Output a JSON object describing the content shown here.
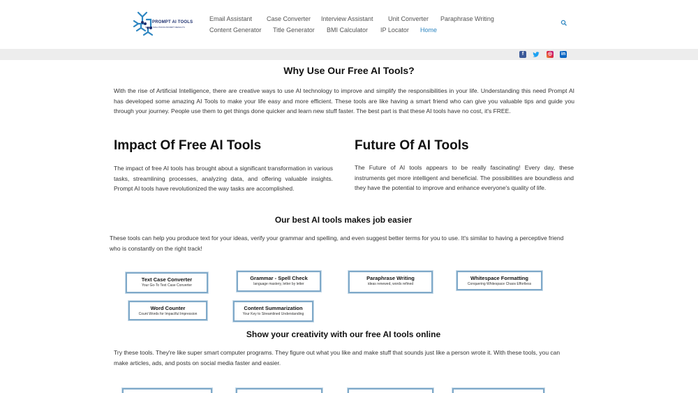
{
  "header": {
    "logo_text": "PROMPT AI TOOLS",
    "logo_tagline": "SMART SOLUTIONS PROMPT RESULTS",
    "nav_row1": [
      "Email Assistant",
      "Case Converter",
      "Interview Assistant",
      "Unit Converter",
      "Paraphrase Writing"
    ],
    "nav_row2": [
      "Content Generator",
      "Title Generator",
      "BMI Calculator",
      "IP Locator",
      "Home"
    ],
    "active": "Home",
    "accent_color": "#2e86c1"
  },
  "social": [
    "facebook-icon",
    "twitter-icon",
    "instagram-icon",
    "linkedin-icon"
  ],
  "why": {
    "title": "Why Use Our Free AI Tools?",
    "text": "With the rise of Artificial Intelligence, there are creative ways to use AI technology to improve and simplify the responsibilities in your life. Understanding this need Prompt AI has developed some amazing AI Tools to make your life easy and more efficient. These tools are like having a smart friend who can give you valuable tips and guide you through your journey. People use them to get things done quicker and learn new stuff faster. The best part is that these AI tools have no cost, it's FREE."
  },
  "impact": {
    "title": "Impact Of Free AI Tools",
    "text": "The impact of free AI tools has brought about a significant transformation in various tasks, streamlining processes, analyzing data, and offering valuable insights. Prompt AI tools have revolutionized the way tasks are accomplished."
  },
  "future": {
    "title": "Future Of AI Tools",
    "text": "The Future of AI tools appears to be really fascinating! Every day, these instruments get more intelligent and beneficial. The possibilities are boundless and they have the potential to improve and enhance everyone's quality of life."
  },
  "best": {
    "title": "Our best AI tools makes job easier",
    "text": "These tools can help you produce text for your ideas, verify your grammar and spelling, and even suggest better terms for you to use. It's similar to having a perceptive friend who is constantly on the right track!"
  },
  "tools": [
    {
      "title": "Text Case Converter",
      "subtitle": "Your Go-To Text Case Converter"
    },
    {
      "title": "Grammar - Spell Check",
      "subtitle": "language mastery, letter by letter"
    },
    {
      "title": "Paraphrase Writing",
      "subtitle": "ideas renewed, words refined"
    },
    {
      "title": "Whitespace Formatting",
      "subtitle": "Conquering Whitespace Chaos Effortless"
    },
    {
      "title": "Word Counter",
      "subtitle": "Count Words for Impactful Impression"
    },
    {
      "title": "Content Summarization",
      "subtitle": "Your Key to Streamlined Understanding"
    }
  ],
  "creativity": {
    "title": "Show your creativity with our free AI tools online",
    "text": "Try these tools. They're like super smart computer programs. They figure out what you like and make stuff that sounds just like a person wrote it. With these tools, you can make articles, ads, and posts on social media faster and easier."
  }
}
